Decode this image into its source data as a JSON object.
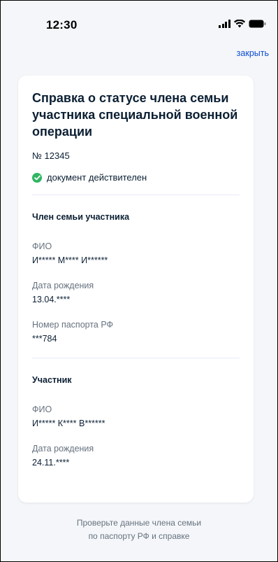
{
  "status_bar": {
    "time": "12:30"
  },
  "header": {
    "close_label": "закрыть"
  },
  "document": {
    "title": "Справка о статусе члена семьи участника специальной военной операции",
    "number": "№ 12345",
    "status_text": "документ действителен",
    "status_color": "#2fb664"
  },
  "family_member": {
    "section_title": "Член семьи участника",
    "fio_label": "ФИО",
    "fio_value": "И***** М**** И******",
    "birth_label": "Дата рождения",
    "birth_value": "13.04.****",
    "passport_label": "Номер паспорта РФ",
    "passport_value": "***784"
  },
  "participant": {
    "section_title": "Участник",
    "fio_label": "ФИО",
    "fio_value": "И***** К**** В******",
    "birth_label": "Дата рождения",
    "birth_value": "24.11.****"
  },
  "footer": {
    "line1": "Проверьте данные члена семьи",
    "line2": "по паспорту РФ и справке"
  },
  "colors": {
    "accent": "#0d4cd3",
    "background": "#f4f6f9",
    "text": "#0b1f33",
    "secondary_text": "#66727f"
  }
}
